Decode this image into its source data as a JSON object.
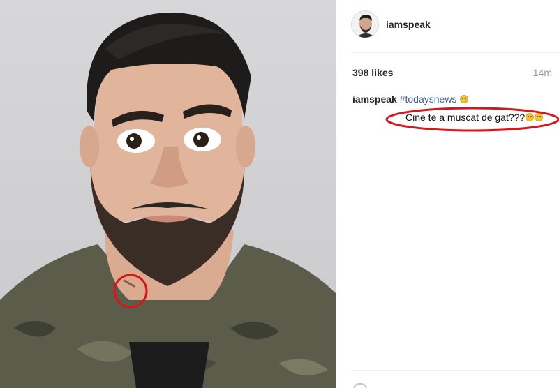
{
  "post": {
    "username": "iamspeak",
    "likes": "398 likes",
    "time": "14m",
    "caption": {
      "username": "iamspeak",
      "hashtag": "#todaysnews",
      "emoji": "flushed-face-emoji"
    },
    "comment": {
      "text": "Cine te a muscat de gat???",
      "emojis": [
        "grinning-face-emoji",
        "grinning-face-emoji"
      ]
    }
  },
  "annotations": {
    "color": "#d9141b",
    "items": [
      "circle-on-neck",
      "oval-around-comment"
    ]
  },
  "photo": {
    "subject": "portrait-photo",
    "background": "#d0d0d2"
  },
  "icons": {
    "avatar": "avatar-icon",
    "comment": "comment-bubble-icon"
  }
}
